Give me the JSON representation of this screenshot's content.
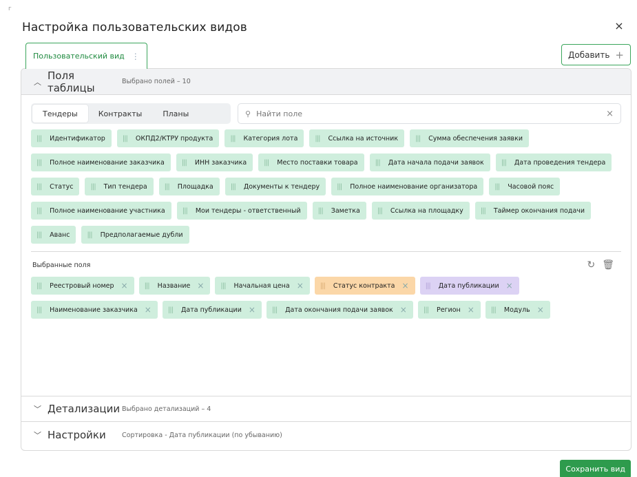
{
  "dialog": {
    "corner_mark": "г",
    "title": "Настройка пользовательских видов",
    "close_glyph": "×"
  },
  "view_tab": {
    "label": "Пользовательский вид",
    "menu_glyph": "⋮"
  },
  "add_button": {
    "label": "Добавить",
    "icon": "+"
  },
  "fields_section": {
    "title": "Поля таблицы",
    "subtitle": "Выбрано полей – 10",
    "tabs": [
      "Тендеры",
      "Контракты",
      "Планы"
    ],
    "active_tab": "Тендеры",
    "search_placeholder": "Найти поле",
    "available_fields": [
      "Идентификатор",
      "ОКПД2/КТРУ продукта",
      "Категория лота",
      "Ссылка на источник",
      "Сумма обеспечения заявки",
      "Полное наименование заказчика",
      "ИНН заказчика",
      "Место поставки товара",
      "Дата начала подачи заявок",
      "Дата проведения тендера",
      "Статус",
      "Тип тендера",
      "Площадка",
      "Документы к тендеру",
      "Полное наименование организатора",
      "Часовой пояс",
      "Полное наименование участника",
      "Мои тендеры - ответственный",
      "Заметка",
      "Ссылка на площадку",
      "Таймер окончания подачи",
      "Аванс",
      "Предполагаемые дубли"
    ],
    "selected_label": "Выбранные поля",
    "selected_fields": [
      {
        "label": "Реестровый номер",
        "color": "green"
      },
      {
        "label": "Название",
        "color": "green"
      },
      {
        "label": "Начальная цена",
        "color": "green"
      },
      {
        "label": "Статус контракта",
        "color": "orange"
      },
      {
        "label": "Дата публикации",
        "color": "purple"
      },
      {
        "label": "Наименование заказчика",
        "color": "green"
      },
      {
        "label": "Дата публикации",
        "color": "green"
      },
      {
        "label": "Дата окончания подачи заявок",
        "color": "green"
      },
      {
        "label": "Регион",
        "color": "green"
      },
      {
        "label": "Модуль",
        "color": "green"
      }
    ]
  },
  "details_section": {
    "title": "Детализации",
    "subtitle": "Выбрано детализаций – 4"
  },
  "settings_section": {
    "title": "Настройки",
    "subtitle": "Сортировка - Дата публикации (по убыванию)"
  },
  "save_button": {
    "label": "Сохранить вид"
  },
  "colors": {
    "accent": "#2e9b4d",
    "chip_green": "#cfeedd",
    "chip_orange": "#fbd7a8",
    "chip_purple": "#dcd2f4"
  }
}
